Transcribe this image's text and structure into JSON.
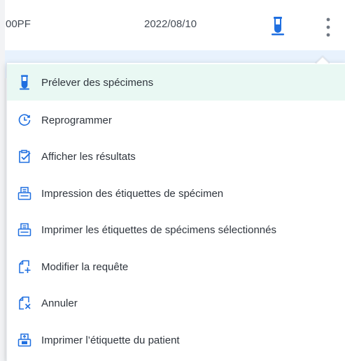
{
  "row": {
    "code": "00PF",
    "date": "2022/08/10"
  },
  "colors": {
    "accent": "#1f6fe0",
    "active_row": "#e9f8f3",
    "selected_row": "#e8f2fd",
    "text": "#2f353d"
  },
  "icons": {
    "collect": "test-tube-icon",
    "reschedule": "clock-arrow-icon",
    "results": "clipboard-check-icon",
    "print": "printer-icon",
    "modify": "document-plus-icon",
    "cancel": "document-x-icon",
    "patient_label": "patient-label-printer-icon",
    "more": "more-vertical-icon"
  },
  "menu": {
    "items": [
      {
        "label": "Prélever des spécimens"
      },
      {
        "label": "Reprogrammer"
      },
      {
        "label": "Afficher les résultats"
      },
      {
        "label": "Impression des étiquettes de spécimen"
      },
      {
        "label": "Imprimer les étiquettes de spécimens sélectionnés"
      },
      {
        "label": "Modifier la requête"
      },
      {
        "label": "Annuler"
      },
      {
        "label": "Imprimer l’étiquette du patient"
      }
    ]
  }
}
